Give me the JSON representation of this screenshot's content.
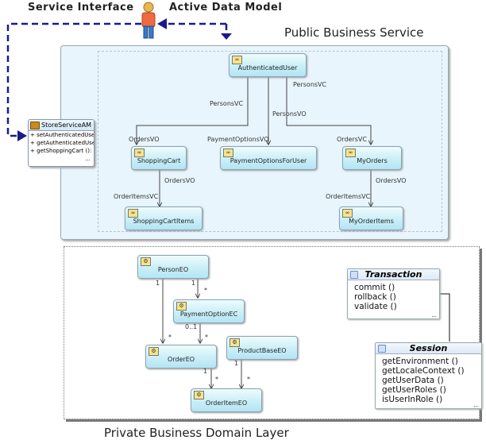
{
  "headers": {
    "service_interface": "Service Interface",
    "active_data_model": "Active Data Model",
    "public_business_service": "Public Business Service",
    "private_business_domain_layer": "Private Business Domain Layer"
  },
  "actor": {
    "icon": "user-actor-icon"
  },
  "application_module": {
    "name": "StoreServiceAM",
    "methods": [
      "+ setAuthenticatedUse",
      "+ getAuthenticatedUse",
      "+ getShoppingCart ():"
    ],
    "more": "..."
  },
  "view_objects": {
    "authenticated_user": "AuthenticatedUser",
    "shopping_cart": "ShoppingCart",
    "payment_options_for_user": "PaymentOptionsForUser",
    "my_orders": "MyOrders",
    "shopping_cart_items": "ShoppingCartItems",
    "my_order_items": "MyOrderItems"
  },
  "vo_links": {
    "persons_vc_left": "PersonsVC",
    "persons_vc_right": "PersonsVC",
    "persons_vo": "PersonsVO",
    "orders_vo_cart": "OrdersVO",
    "payment_options_vo": "PaymentOptionsVO",
    "orders_vc": "OrdersVC",
    "orders_vo_cart_items": "OrdersVO",
    "order_items_vc_cart": "OrderItemsVC",
    "orders_vo_my_items": "OrdersVO",
    "order_items_vc_my": "OrderItemsVC"
  },
  "entity_objects": {
    "person": "PersonEO",
    "payment_option": "PaymentOptionEC",
    "order": "OrderEO",
    "product_base": "ProductBaseEO",
    "order_item": "OrderItemEO"
  },
  "multiplicities": {
    "person_order_1": "1",
    "person_payment_1": "1",
    "person_payment_many": "*",
    "payment_order_01": "0..1",
    "person_order_many": "*",
    "payment_order_many": "*",
    "order_item_1": "1",
    "order_item_many": "*",
    "product_item_1": "1",
    "product_item_many": "*"
  },
  "transaction": {
    "title": "Transaction",
    "operations": [
      "commit ()",
      "rollback ()",
      "validate ()"
    ],
    "more": "..."
  },
  "session": {
    "title": "Session",
    "operations": [
      "getEnvironment ()",
      "getLocaleContext ()",
      "getUserData ()",
      "getUserRoles ()",
      "isUserInRole ()"
    ],
    "more": "..."
  },
  "colors": {
    "dashed_arrow": "#1a1a8c",
    "panel_bg": "#e8f5fc",
    "node_gradient_top": "#eefcfc",
    "node_gradient_bottom": "#b4e4f4"
  }
}
